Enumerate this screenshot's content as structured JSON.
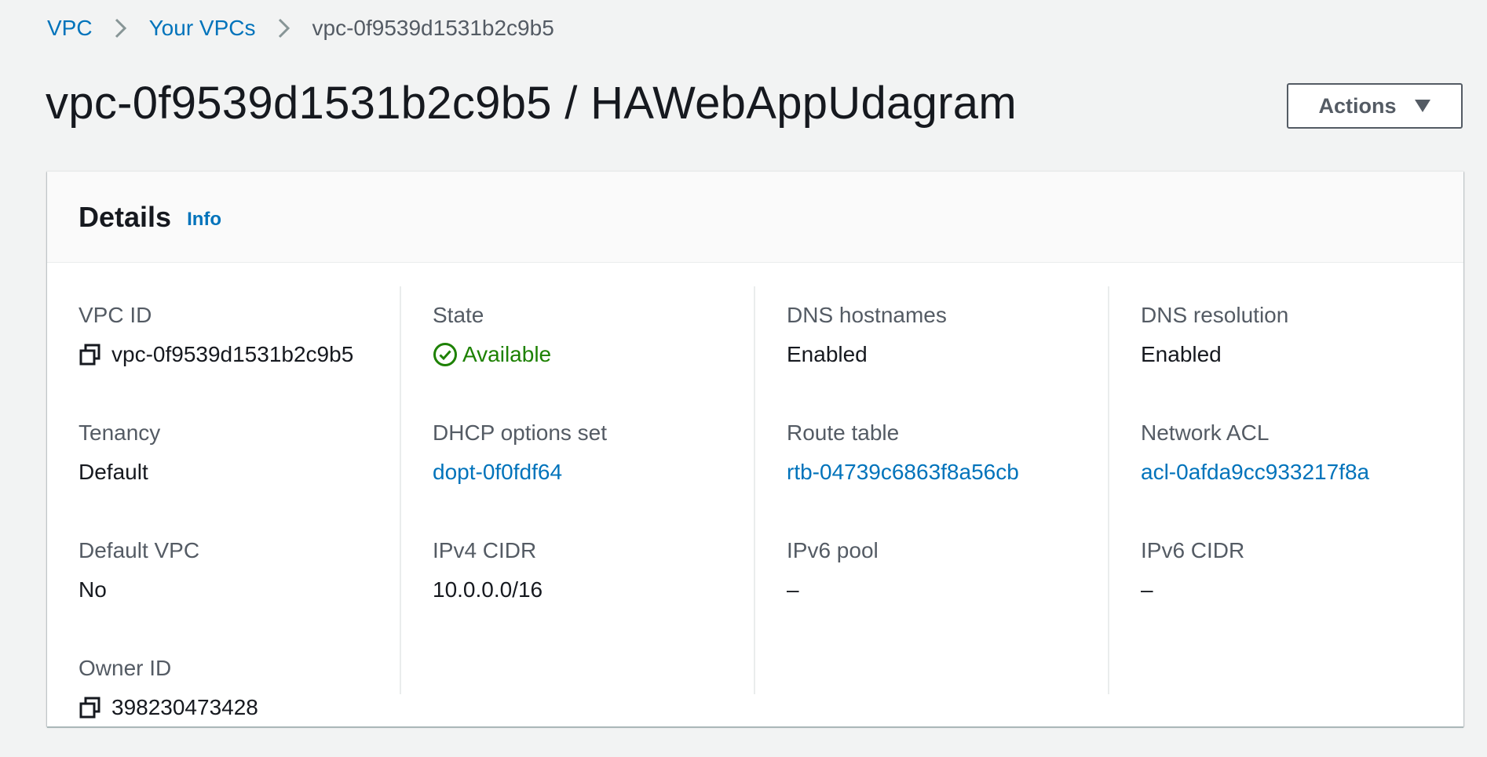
{
  "breadcrumb": {
    "items": [
      {
        "label": "VPC"
      },
      {
        "label": "Your VPCs"
      },
      {
        "label": "vpc-0f9539d1531b2c9b5"
      }
    ]
  },
  "header": {
    "title": "vpc-0f9539d1531b2c9b5 / HAWebAppUdagram",
    "actions_label": "Actions",
    "actions_icon": "caret-down-icon"
  },
  "details": {
    "title": "Details",
    "info_label": "Info",
    "columns": [
      [
        {
          "label": "VPC ID",
          "value": "vpc-0f9539d1531b2c9b5",
          "icon": "copy-icon"
        },
        {
          "label": "Tenancy",
          "value": "Default"
        },
        {
          "label": "Default VPC",
          "value": "No"
        },
        {
          "label": "Owner ID",
          "value": "398230473428",
          "icon": "copy-icon"
        }
      ],
      [
        {
          "label": "State",
          "value": "Available",
          "icon": "check-circle-icon",
          "color": "#1d8102"
        },
        {
          "label": "DHCP options set",
          "value": "dopt-0f0fdf64",
          "link": true
        },
        {
          "label": "IPv4 CIDR",
          "value": "10.0.0.0/16"
        }
      ],
      [
        {
          "label": "DNS hostnames",
          "value": "Enabled"
        },
        {
          "label": "Route table",
          "value": "rtb-04739c6863f8a56cb",
          "link": true
        },
        {
          "label": "IPv6 pool",
          "value": "–"
        }
      ],
      [
        {
          "label": "DNS resolution",
          "value": "Enabled"
        },
        {
          "label": "Network ACL",
          "value": "acl-0afda9cc933217f8a",
          "link": true
        },
        {
          "label": "IPv6 CIDR",
          "value": "–"
        }
      ]
    ]
  },
  "colors": {
    "link": "#0073bb",
    "success": "#1d8102",
    "label": "#545b64",
    "text": "#16191f"
  }
}
